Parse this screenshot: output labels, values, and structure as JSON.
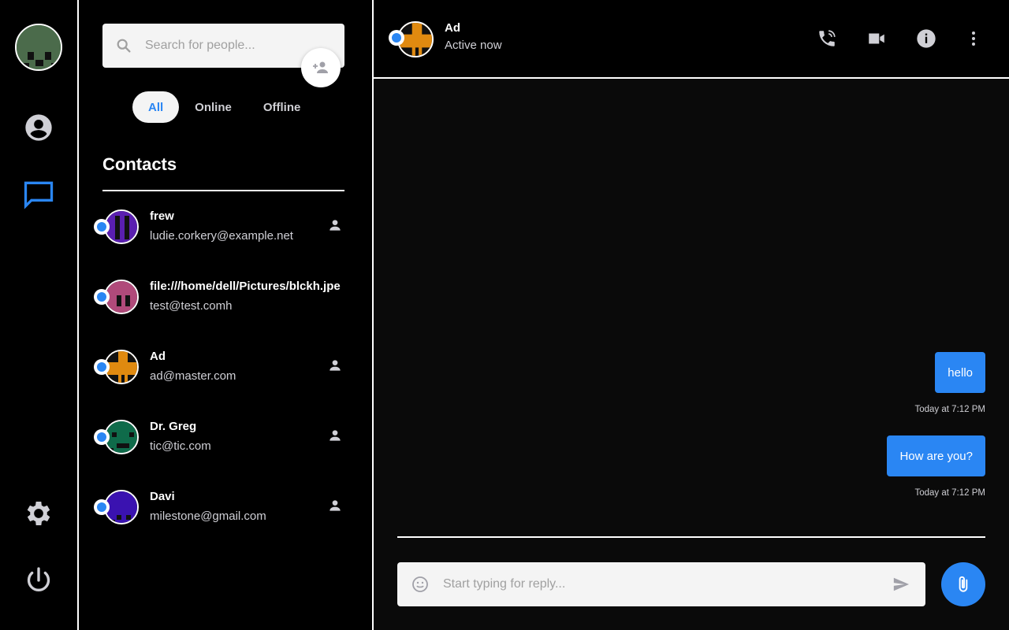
{
  "colors": {
    "accent": "#2a86f3",
    "background": "#000000",
    "panel_border": "#ffffff",
    "input_bg": "#f4f4f4"
  },
  "rail": {
    "icons": [
      "user-avatar",
      "account-circle-icon",
      "chat-icon",
      "moon-icon",
      "gear-icon",
      "power-icon"
    ],
    "active_item": "chat-icon"
  },
  "search": {
    "placeholder": "Search for people..."
  },
  "filters": [
    {
      "label": "All",
      "active": true
    },
    {
      "label": "Online",
      "active": false
    },
    {
      "label": "Offline",
      "active": false
    }
  ],
  "contacts": {
    "title": "Contacts",
    "items": [
      {
        "name": "frew",
        "email": "ludie.corkery@example.net",
        "avatar_color": "#5a1fb0",
        "online": true,
        "show_person_icon": true
      },
      {
        "name": "file:///home/dell/Pictures/blckh.jpe",
        "email": "test@test.comh",
        "avatar_color": "#b04a7a",
        "online": true,
        "show_person_icon": false
      },
      {
        "name": "Ad",
        "email": "ad@master.com",
        "avatar_color": "#e08a10",
        "online": true,
        "show_person_icon": true
      },
      {
        "name": "Dr. Greg",
        "email": "tic@tic.com",
        "avatar_color": "#0f6b4a",
        "online": true,
        "show_person_icon": true
      },
      {
        "name": "Davi",
        "email": "milestone@gmail.com",
        "avatar_color": "#3a12b0",
        "online": true,
        "show_person_icon": true
      }
    ]
  },
  "chat": {
    "name": "Ad",
    "status": "Active now",
    "header_actions": [
      "phone-icon",
      "video-icon",
      "info-icon",
      "more-vert-icon"
    ],
    "messages": [
      {
        "text": "hello",
        "time": "Today at 7:12 PM"
      },
      {
        "text": "How are you?",
        "time": "Today at 7:12 PM"
      }
    ],
    "compose_placeholder": "Start typing for reply..."
  }
}
